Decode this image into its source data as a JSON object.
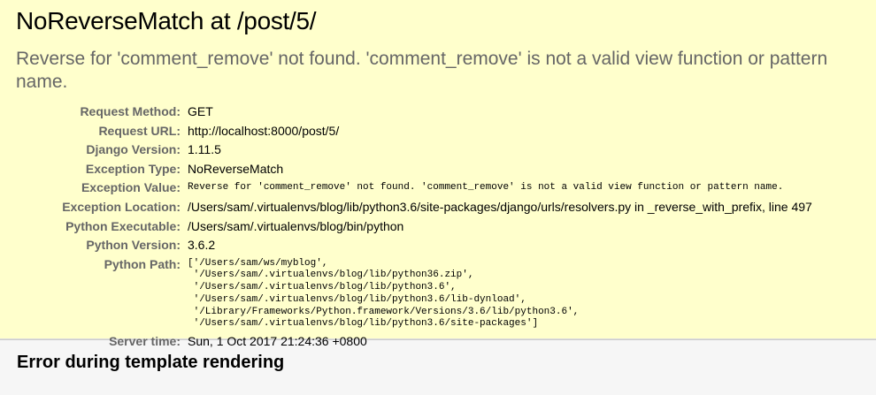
{
  "summary": {
    "title": "NoReverseMatch at /post/5/",
    "exception_message": "Reverse for 'comment_remove' not found. 'comment_remove' is not a valid view function or pattern name.",
    "meta": {
      "request_method_label": "Request Method:",
      "request_method": "GET",
      "request_url_label": "Request URL:",
      "request_url": "http://localhost:8000/post/5/",
      "django_version_label": "Django Version:",
      "django_version": "1.11.5",
      "exception_type_label": "Exception Type:",
      "exception_type": "NoReverseMatch",
      "exception_value_label": "Exception Value:",
      "exception_value": "Reverse for 'comment_remove' not found. 'comment_remove' is not a valid view function or pattern name.",
      "exception_location_label": "Exception Location:",
      "exception_location": "/Users/sam/.virtualenvs/blog/lib/python3.6/site-packages/django/urls/resolvers.py in _reverse_with_prefix, line 497",
      "python_executable_label": "Python Executable:",
      "python_executable": "/Users/sam/.virtualenvs/blog/bin/python",
      "python_version_label": "Python Version:",
      "python_version": "3.6.2",
      "python_path_label": "Python Path:",
      "python_path": "['/Users/sam/ws/myblog',\n '/Users/sam/.virtualenvs/blog/lib/python36.zip',\n '/Users/sam/.virtualenvs/blog/lib/python3.6',\n '/Users/sam/.virtualenvs/blog/lib/python3.6/lib-dynload',\n '/Library/Frameworks/Python.framework/Versions/3.6/lib/python3.6',\n '/Users/sam/.virtualenvs/blog/lib/python3.6/site-packages']",
      "server_time_label": "Server time:",
      "server_time": "Sun, 1 Oct 2017 21:24:36 +0800"
    }
  },
  "template_section": {
    "heading": "Error during template rendering"
  },
  "colors": {
    "summary_bg": "#ffffcc",
    "label_gray": "#666666",
    "section_bg": "#f6f6f6"
  }
}
